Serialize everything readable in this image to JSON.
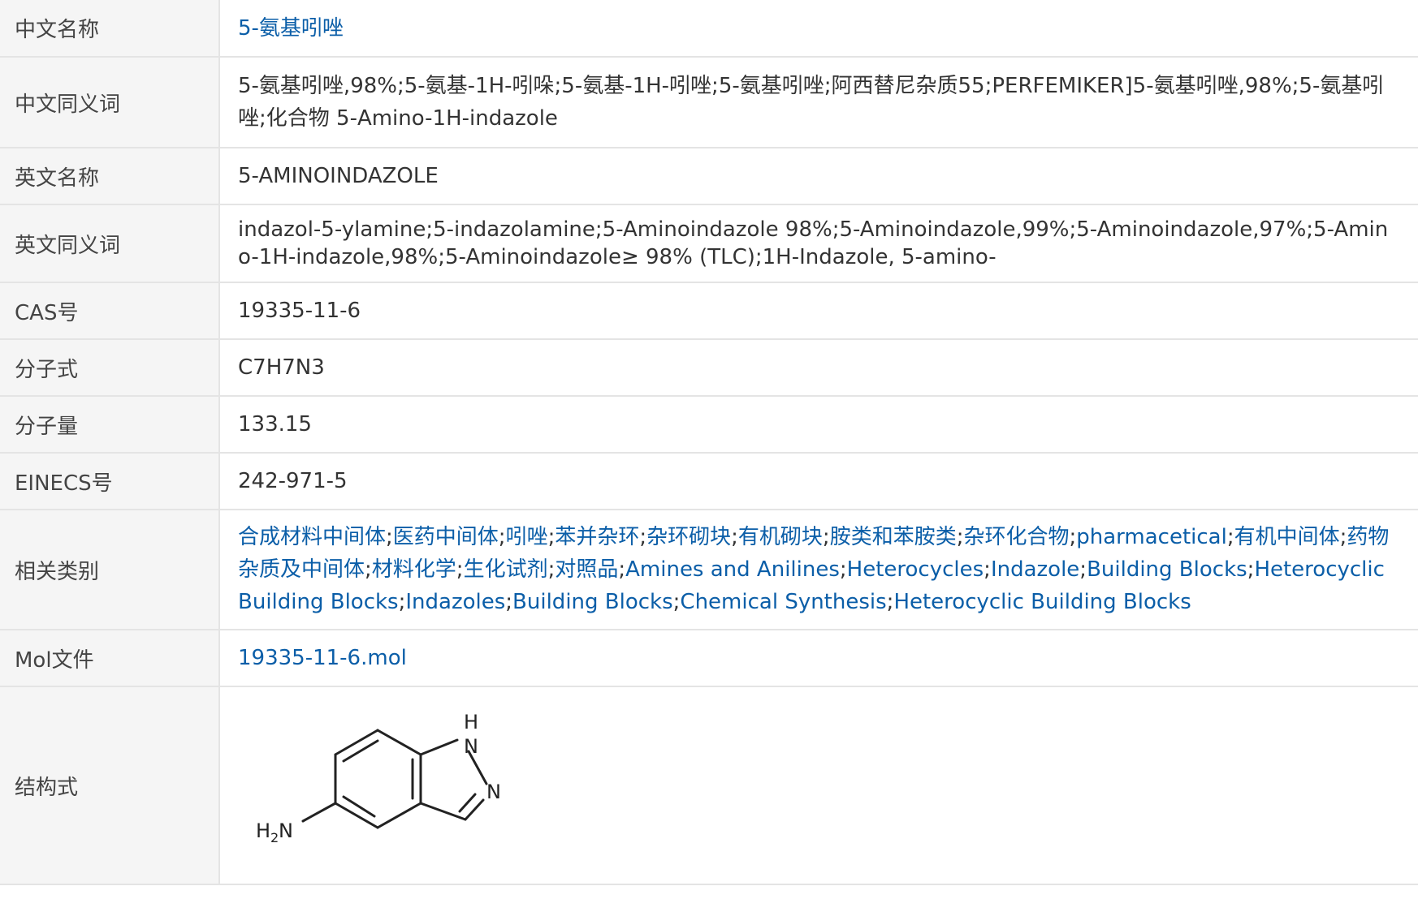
{
  "rows": {
    "cn_name": {
      "label": "中文名称",
      "value": "5-氨基吲唑"
    },
    "cn_synonyms": {
      "label": "中文同义词",
      "value": "5-氨基吲唑,98%;5-氨基-1H-吲哚;5-氨基-1H-吲唑;5-氨基吲唑;阿西替尼杂质55;PERFEMIKER]5-氨基吲唑,98%;5-氨基吲唑;化合物 5-Amino-1H-indazole"
    },
    "en_name": {
      "label": "英文名称",
      "value": "5-AMINOINDAZOLE"
    },
    "en_synonyms": {
      "label": "英文同义词",
      "value": "indazol-5-ylamine;5-indazolamine;5-Aminoindazole 98%;5-Aminoindazole,99%;5-Aminoindazole,97%;5-Amino-1H-indazole,98%;5-Aminoindazole≥ 98% (TLC);1H-Indazole, 5-amino-"
    },
    "cas": {
      "label": "CAS号",
      "value": "19335-11-6"
    },
    "formula": {
      "label": "分子式",
      "value": "C7H7N3"
    },
    "mw": {
      "label": "分子量",
      "value": "133.15"
    },
    "einecs": {
      "label": "EINECS号",
      "value": "242-971-5"
    },
    "categories": {
      "label": "相关类别",
      "items": [
        "合成材料中间体",
        "医药中间体",
        "吲唑",
        "苯并杂环",
        "杂环砌块",
        "有机砌块",
        "胺类和苯胺类",
        "杂环化合物",
        "pharmacetical",
        "有机中间体",
        "药物杂质及中间体",
        "材料化学",
        "生化试剂",
        "对照品",
        "Amines and Anilines",
        "Heterocycles",
        "Indazole",
        "Building Blocks",
        "Heterocyclic Building Blocks",
        "Indazoles",
        "Building Blocks",
        "Chemical Synthesis",
        "Heterocyclic Building Blocks"
      ]
    },
    "mol_file": {
      "label": "Mol文件",
      "value": "19335-11-6.mol"
    },
    "structure": {
      "label": "结构式",
      "atoms": {
        "h": "H",
        "n1": "N",
        "n2": "N",
        "h2": "H",
        "sub2": "2",
        "n3": "N"
      }
    }
  },
  "colors": {
    "link": "#0b5ea8",
    "label_bg": "#f5f5f5",
    "border": "#e4e4e4"
  }
}
